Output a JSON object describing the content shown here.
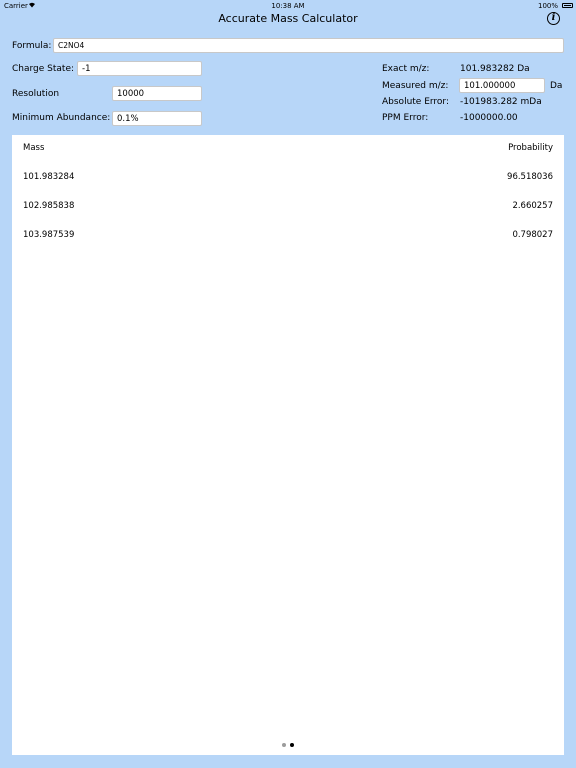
{
  "status": {
    "carrier": "Carrier",
    "time": "10:38 AM",
    "battery": "100%"
  },
  "nav": {
    "title": "Accurate Mass Calculator",
    "info_icon": "info-icon"
  },
  "form": {
    "formula_label": "Formula:",
    "formula_value": "C2NO4",
    "charge_label": "Charge State:",
    "charge_value": "-1",
    "resolution_label": "Resolution",
    "resolution_value": "10000",
    "min_abundance_label": "Minimum Abundance:",
    "min_abundance_value": "0.1%"
  },
  "summary": {
    "exact_label": "Exact m/z:",
    "exact_value": "101.983282 Da",
    "measured_label": "Measured m/z:",
    "measured_value": "101.000000",
    "measured_unit": "Da",
    "abs_error_label": "Absolute Error:",
    "abs_error_value": "-101983.282 mDa",
    "ppm_label": "PPM Error:",
    "ppm_value": "-1000000.00"
  },
  "table": {
    "headers": [
      "Mass",
      "Probability"
    ],
    "rows": [
      [
        "101.983284",
        "96.518036"
      ],
      [
        "102.985838",
        "2.660257"
      ],
      [
        "103.987539",
        "0.798027"
      ]
    ]
  },
  "pager": {
    "pages": 2,
    "current": 2
  }
}
